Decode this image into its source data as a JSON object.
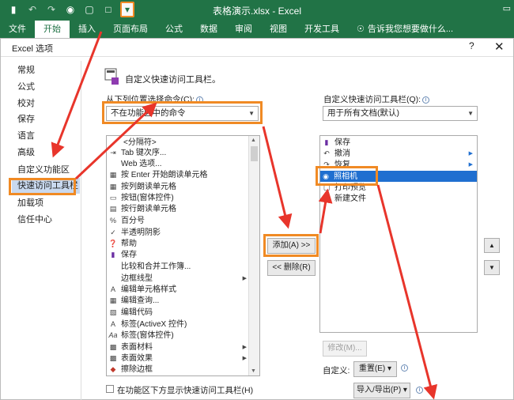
{
  "titlebar": {
    "title": "表格演示.xlsx - Excel",
    "qat_icons": [
      "save-icon",
      "undo-icon",
      "redo-icon",
      "camera-icon",
      "print-preview-icon",
      "new-file-icon",
      "customize-qat-icon"
    ]
  },
  "ribbon": {
    "tabs": [
      "文件",
      "开始",
      "插入",
      "页面布局",
      "公式",
      "数据",
      "审阅",
      "视图",
      "开发工具"
    ],
    "active_tab": "开始",
    "tell_me": "告诉我您想要做什么..."
  },
  "dialog": {
    "title": "Excel 选项",
    "help": "?",
    "close": "✕",
    "nav": [
      "常规",
      "公式",
      "校对",
      "保存",
      "语言",
      "高级",
      "自定义功能区",
      "快速访问工具栏",
      "加载项",
      "信任中心"
    ],
    "selected_nav": "快速访问工具栏",
    "heading": "自定义快速访问工具栏。",
    "choose_label": "从下列位置选择命令(C):",
    "choose_value": "不在功能区中的命令",
    "customize_label": "自定义快速访问工具栏(Q):",
    "customize_value": "用于所有文档(默认)",
    "commands": [
      {
        "icon": "",
        "label": "<分隔符>",
        "submenu": false
      },
      {
        "icon": "tab-key-icon",
        "label": "Tab 键次序...",
        "submenu": false
      },
      {
        "icon": "",
        "label": "Web 选项...",
        "submenu": false
      },
      {
        "icon": "speak-enter-icon",
        "label": "按 Enter 开始朗读单元格",
        "submenu": false
      },
      {
        "icon": "speak-cols-icon",
        "label": "按列朗读单元格",
        "submenu": false
      },
      {
        "icon": "button-control-icon",
        "label": "按钮(窗体控件)",
        "submenu": false
      },
      {
        "icon": "speak-rows-icon",
        "label": "按行朗读单元格",
        "submenu": false
      },
      {
        "icon": "percent-icon",
        "label": "百分号",
        "submenu": false
      },
      {
        "icon": "check-icon",
        "label": "半透明阴影",
        "submenu": false
      },
      {
        "icon": "help-icon",
        "label": "帮助",
        "submenu": false
      },
      {
        "icon": "save-icon",
        "label": "保存",
        "submenu": false
      },
      {
        "icon": "",
        "label": "比较和合并工作簿...",
        "submenu": false
      },
      {
        "icon": "",
        "label": "边框线型",
        "submenu": true
      },
      {
        "icon": "edit-style-icon",
        "label": "编辑单元格样式",
        "submenu": false
      },
      {
        "icon": "edit-query-icon",
        "label": "编辑查询...",
        "submenu": false
      },
      {
        "icon": "edit-code-icon",
        "label": "编辑代码",
        "submenu": false
      },
      {
        "icon": "label-activex-icon",
        "label": "标签(ActiveX 控件)",
        "submenu": false
      },
      {
        "icon": "label-form-icon",
        "label": "标签(窗体控件)",
        "submenu": false
      },
      {
        "icon": "texture-icon",
        "label": "表面材料",
        "submenu": true
      },
      {
        "icon": "effect-icon",
        "label": "表面效果",
        "submenu": true
      },
      {
        "icon": "eraser-icon",
        "label": "擦除边框",
        "submenu": false
      }
    ],
    "qat_items": [
      {
        "icon": "save-icon",
        "label": "保存",
        "submenu": false
      },
      {
        "icon": "undo-icon",
        "label": "撤消",
        "submenu": true
      },
      {
        "icon": "redo-icon",
        "label": "恢复",
        "submenu": true
      },
      {
        "icon": "camera-icon",
        "label": "照相机",
        "submenu": false
      },
      {
        "icon": "print-preview-icon",
        "label": "打印预览",
        "submenu": false
      },
      {
        "icon": "new-file-icon",
        "label": "新建文件",
        "submenu": false
      }
    ],
    "selected_qat": "照相机",
    "add_button": "添加(A) >>",
    "remove_button": "<< 删除(R)",
    "modify_button": "修改(M)...",
    "customize_caption": "自定义:",
    "reset_button": "重置(E) ▾",
    "import_export_button": "导入/导出(P) ▾",
    "show_below_label": "在功能区下方显示快速访问工具栏(H)"
  },
  "colors": {
    "excel_green": "#217346",
    "highlight_orange": "#f08a24",
    "arrow_red": "#e8352b",
    "selection_blue": "#1f6fd0"
  }
}
